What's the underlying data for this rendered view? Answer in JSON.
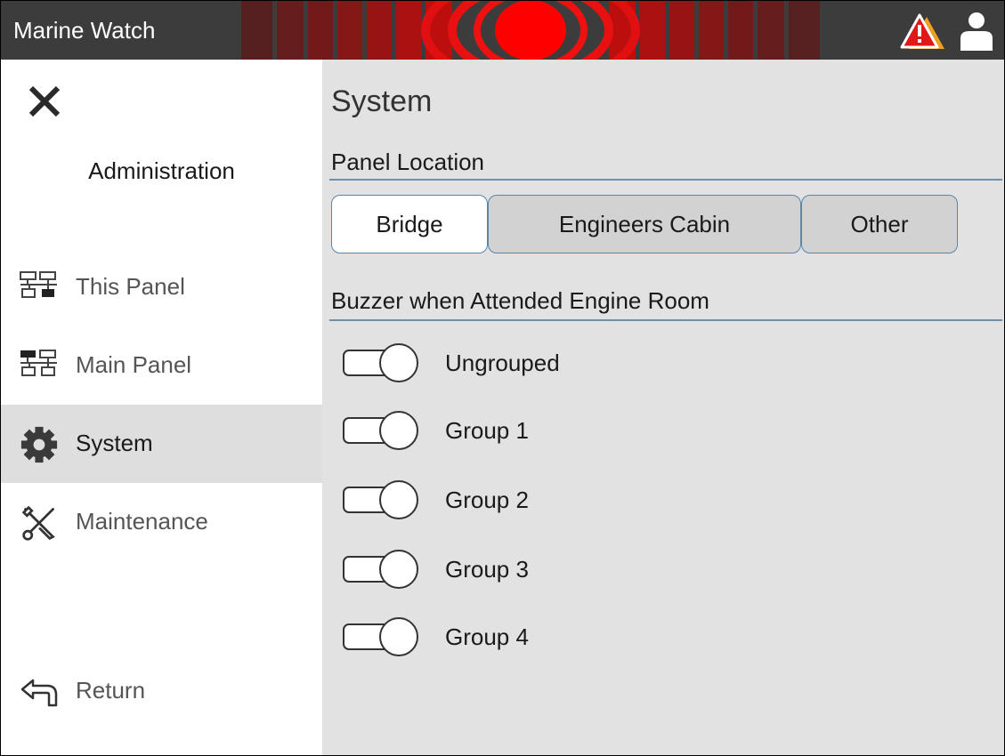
{
  "header": {
    "app_title": "Marine Watch",
    "alarm_color": "#ff0000",
    "icons": [
      "alarm-burst-icon",
      "warning-triangle-icon",
      "user-icon"
    ]
  },
  "sidebar": {
    "close_icon": "close-icon",
    "heading": "Administration",
    "items": [
      {
        "id": "this-panel",
        "label": "This Panel",
        "icon": "network-icon",
        "active": false
      },
      {
        "id": "main-panel",
        "label": "Main Panel",
        "icon": "network-icon",
        "active": false
      },
      {
        "id": "system",
        "label": "System",
        "icon": "gear-icon",
        "active": true
      },
      {
        "id": "maintenance",
        "label": "Maintenance",
        "icon": "tools-icon",
        "active": false
      },
      {
        "id": "return",
        "label": "Return",
        "icon": "return-arrow-icon",
        "active": false
      }
    ]
  },
  "main": {
    "title": "System",
    "panel_location": {
      "title": "Panel Location",
      "options": [
        "Bridge",
        "Engineers Cabin",
        "Other"
      ],
      "selected": "Bridge"
    },
    "buzzer": {
      "title": "Buzzer when Attended Engine Room",
      "toggles": [
        {
          "label": "Ungrouped",
          "on": false
        },
        {
          "label": "Group 1",
          "on": false
        },
        {
          "label": "Group 2",
          "on": false
        },
        {
          "label": "Group 3",
          "on": false
        },
        {
          "label": "Group 4",
          "on": false
        }
      ]
    }
  },
  "colors": {
    "header_bg": "#3c3c3c",
    "accent_rule": "#6d8fae",
    "active_nav": "#dedede",
    "main_bg": "#e2e2e2"
  }
}
